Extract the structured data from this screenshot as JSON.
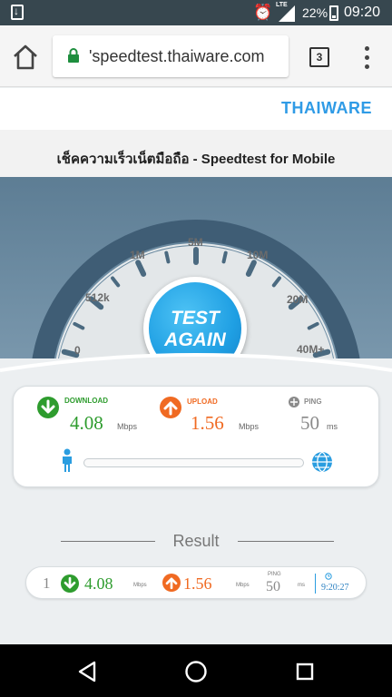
{
  "status_bar": {
    "network": "LTE",
    "battery_percent": "22%",
    "time": "09:20",
    "icons": [
      "download-notification-icon",
      "alarm-icon",
      "signal-icon",
      "battery-icon"
    ]
  },
  "browser": {
    "url": "'speedtest.thaiware.com",
    "tab_count": "3",
    "icons": [
      "home-icon",
      "lock-icon",
      "overflow-menu-icon"
    ]
  },
  "site": {
    "logo": "THAIWARE",
    "title": "เช็คความเร็วเน็ตมือถือ - Speedtest for Mobile"
  },
  "gauge": {
    "labels": [
      "0",
      "512k",
      "1M",
      "5M",
      "10M",
      "20M",
      "40M+"
    ],
    "button_line1": "TEST",
    "button_line2": "AGAIN"
  },
  "speed": {
    "download_label": "DOWNLOAD",
    "download_value": "4.08",
    "upload_label": "UPLOAD",
    "upload_value": "1.56",
    "ping_label": "PING",
    "ping_value": "50",
    "speed_unit": "Mbps",
    "ping_unit": "ms",
    "colors": {
      "download": "#2e9c2e",
      "upload": "#f06a22",
      "ping": "#8a8a8a",
      "accent": "#1f9fe3"
    }
  },
  "result": {
    "title": "Result",
    "rows": [
      {
        "index": "1",
        "download": "4.08",
        "download_unit": "Mbps",
        "upload": "1.56",
        "upload_unit": "Mbps",
        "ping_label": "PING",
        "ping": "50",
        "ping_unit": "ms",
        "time": "9:20:27"
      }
    ]
  },
  "nav": {
    "icons": [
      "back-icon",
      "home-icon",
      "recents-icon"
    ]
  }
}
